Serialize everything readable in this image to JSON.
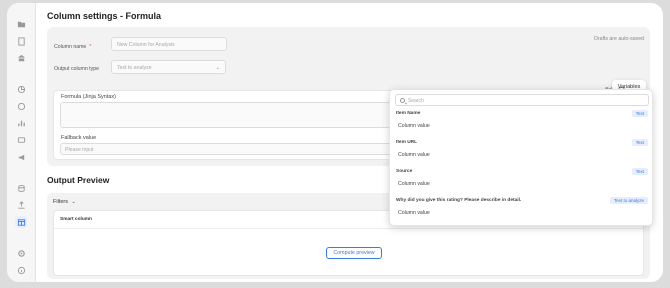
{
  "page": {
    "title": "Column settings - Formula",
    "autosave_note": "Drafts are auto-saved"
  },
  "form": {
    "column_name_label": "Column name",
    "column_name_placeholder": "New Column for Analysis",
    "required_mark": "*",
    "output_type_label": "Output column type",
    "output_type_value": "Text to analyze",
    "formula_label": "Formula (Jinja Syntax)",
    "fallback_label": "Fallback value",
    "fallback_placeholder": "Please input"
  },
  "toolbar": {
    "variables_tooltip": "Variables",
    "fx_label": "f(x)"
  },
  "variables_dropdown": {
    "search_placeholder": "Search",
    "items": [
      {
        "name": "Item Name",
        "tag": "Text",
        "value": "Column value"
      },
      {
        "name": "Item URL",
        "tag": "Text",
        "value": "Column value"
      },
      {
        "name": "Source",
        "tag": "Text",
        "value": "Column value"
      },
      {
        "name": "Why did you give this rating? Please describe in detail.",
        "tag": "Text to analyze",
        "value": "Column value"
      }
    ]
  },
  "preview": {
    "title": "Output Preview",
    "filters_label": "Filters",
    "column_header": "Smart column",
    "compute_button": "Compute preview"
  },
  "colors": {
    "accent": "#3d7be0",
    "tag_bg": "#e4eefc",
    "required": "#e04c4c"
  }
}
